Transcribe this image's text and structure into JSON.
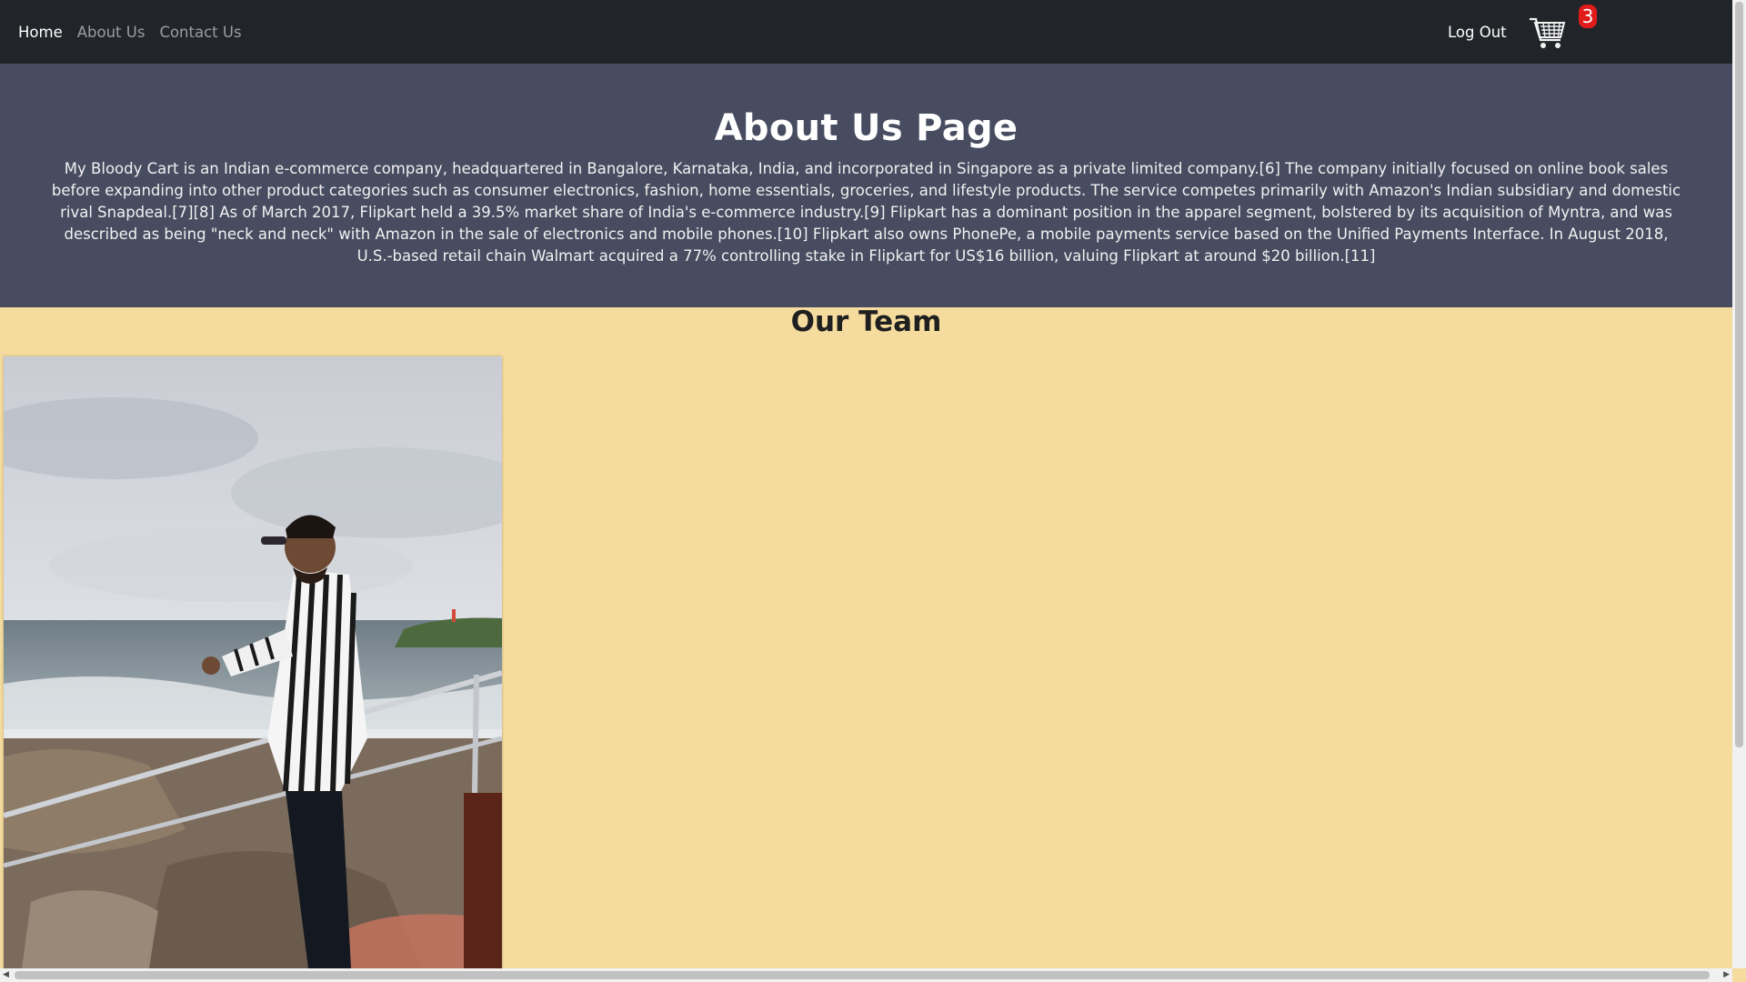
{
  "navbar": {
    "links": [
      {
        "label": "Home",
        "active": true
      },
      {
        "label": "About Us",
        "active": false
      },
      {
        "label": "Contact Us",
        "active": false
      }
    ],
    "logout_label": "Log Out",
    "cart_icon": "shopping-cart-icon",
    "cart_count": "3"
  },
  "hero": {
    "title": "About Us Page",
    "body": "My Bloody Cart is an Indian e-commerce company, headquartered in Bangalore, Karnataka, India, and incorporated in Singapore as a private limited company.[6] The company initially focused on online book sales before expanding into other product categories such as consumer electronics, fashion, home essentials, groceries, and lifestyle products. The service competes primarily with Amazon's Indian subsidiary and domestic rival Snapdeal.[7][8] As of March 2017, Flipkart held a 39.5% market share of India's e-commerce industry.[9] Flipkart has a dominant position in the apparel segment, bolstered by its acquisition of Myntra, and was described as being \"neck and neck\" with Amazon in the sale of electronics and mobile phones.[10] Flipkart also owns PhonePe, a mobile payments service based on the Unified Payments Interface. In August 2018, U.S.-based retail chain Walmart acquired a 77% controlling stake in Flipkart for US$16 billion, valuing Flipkart at around $20 billion.[11]"
  },
  "team": {
    "title": "Our Team"
  },
  "colors": {
    "navbar": "#212529",
    "hero": "#474c60",
    "team_bg": "#f5dc9e",
    "badge": "#e11a1a"
  }
}
